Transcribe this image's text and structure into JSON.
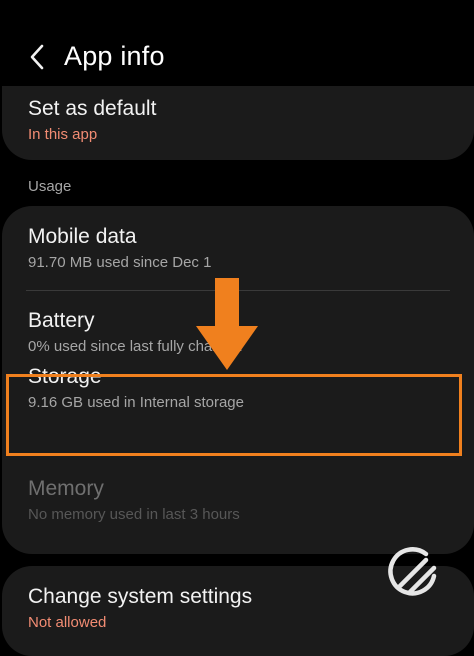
{
  "header": {
    "title": "App info",
    "back_icon": "chevron-left-icon"
  },
  "set_as_default": {
    "label": "Set as default",
    "sub": "In this app"
  },
  "section": {
    "usage": "Usage"
  },
  "items": {
    "mobile_data": {
      "label": "Mobile data",
      "sub": "91.70 MB used since Dec 1"
    },
    "battery": {
      "label": "Battery",
      "sub": "0% used since last fully charged"
    },
    "storage": {
      "label": "Storage",
      "sub": "9.16 GB used in Internal storage"
    },
    "memory": {
      "label": "Memory",
      "sub": "No memory used in last 3 hours"
    }
  },
  "change_system_settings": {
    "label": "Change system settings",
    "sub": "Not allowed"
  },
  "annotation": {
    "highlight_color": "#f0801e",
    "arrow_icon": "down-arrow-icon",
    "watermark_icon": "logo-icon"
  },
  "colors": {
    "background": "#000000",
    "card": "#1b1b1b",
    "accent_subtitle": "#f28c73"
  }
}
